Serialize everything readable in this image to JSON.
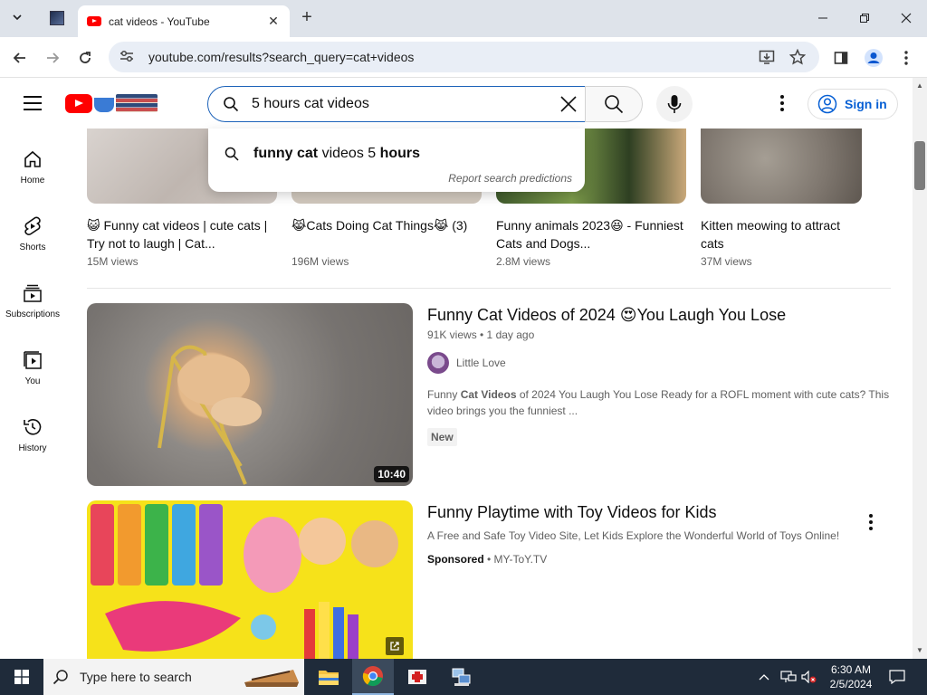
{
  "browser": {
    "tab_title": "cat videos - YouTube",
    "url": "youtube.com/results?search_query=cat+videos"
  },
  "search": {
    "query": "5 hours cat videos",
    "suggestions": [
      {
        "text_bold_1": "funny cat",
        "text_normal": " videos 5 ",
        "text_bold_2": "hours"
      }
    ],
    "report_label": "Report search predictions"
  },
  "header": {
    "sign_in_label": "Sign in"
  },
  "guide": {
    "items": [
      {
        "label": "Home",
        "icon": "home-icon"
      },
      {
        "label": "Shorts",
        "icon": "shorts-icon"
      },
      {
        "label": "Subscriptions",
        "icon": "subscriptions-icon"
      },
      {
        "label": "You",
        "icon": "you-icon"
      },
      {
        "label": "History",
        "icon": "history-icon"
      }
    ]
  },
  "shelf": [
    {
      "title": "😺 Funny cat videos | cute cats | Try not to laugh | Cat...",
      "views": "15M views"
    },
    {
      "title": "😹Cats Doing Cat Things😹 (3)",
      "views": "196M views"
    },
    {
      "title": "Funny animals 2023😆 - Funniest Cats and Dogs...",
      "views": "2.8M views"
    },
    {
      "title": "Kitten meowing to attract cats",
      "views": "37M views"
    }
  ],
  "videos": [
    {
      "title": "Funny Cat Videos of 2024 😍You Laugh You Lose",
      "meta": "91K views • 1 day ago",
      "channel": "Little Love",
      "desc_pre": "Funny ",
      "desc_bold": "Cat Videos",
      "desc_post": " of 2024 You Laugh You Lose Ready for a ROFL moment with cute cats? This video brings you the funniest ...",
      "badge": "New",
      "duration": "10:40"
    }
  ],
  "ad": {
    "title": "Funny Playtime with Toy Videos for Kids",
    "description": "A Free and Safe Toy Video Site, Let Kids Explore the Wonderful World of Toys Online!",
    "sponsored_label": "Sponsored",
    "separator": " • ",
    "advertiser": "MY-ToY.TV"
  },
  "taskbar": {
    "search_placeholder": "Type here to search",
    "time": "6:30 AM",
    "date": "2/5/2024"
  },
  "colors": {
    "yt_red": "#ff0000",
    "link_blue": "#065fd4",
    "search_focus": "#1c62b9"
  }
}
